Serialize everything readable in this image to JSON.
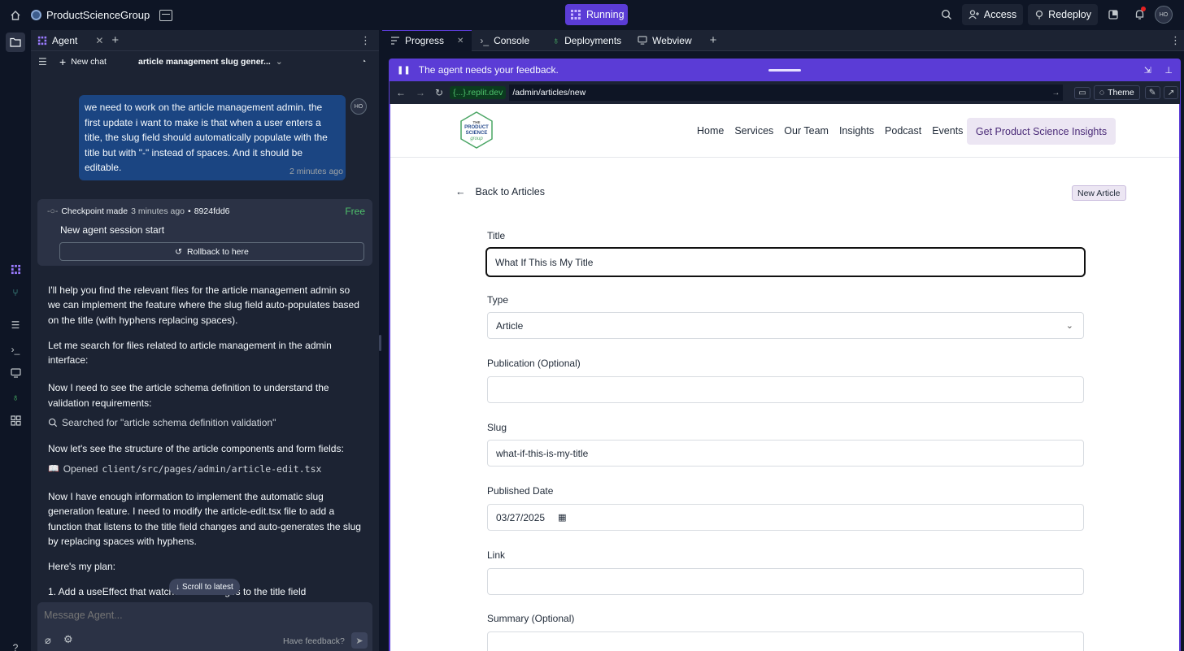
{
  "topbar": {
    "project_name": "ProductScienceGroup",
    "status": "Running",
    "access_label": "Access",
    "redeploy_label": "Redeploy",
    "avatar": "HO"
  },
  "agent": {
    "tab_label": "Agent",
    "new_chat": "New chat",
    "chat_title": "article management slug gener...",
    "user_message": "we need to work on the article management admin. the first update i want to make is that when a user enters a title, the slug field should automatically populate with the title but with \"-\" instead of spaces. And it should be editable.",
    "user_avatar": "HO",
    "timestamp": "2 minutes ago",
    "checkpoint": {
      "label": "Checkpoint made",
      "time": "3 minutes ago",
      "bullet": "•",
      "hash": "8924fdd6",
      "price": "Free",
      "title": "New agent session start",
      "rollback": "Rollback to here"
    },
    "messages": {
      "m1": "I'll help you find the relevant files for the article management admin so we can implement the feature where the slug field auto-populates based on the title (with hyphens replacing spaces).",
      "m2": "Let me search for files related to article management in the admin interface:",
      "m3": "Now I need to see the article schema definition to understand the validation requirements:",
      "tool1": "Searched for \"article schema definition validation\"",
      "m4": "Now let's see the structure of the article components and form fields:",
      "tool2_prefix": "Opened",
      "tool2_file": "client/src/pages/admin/article-edit.tsx",
      "m5": "Now I have enough information to implement the automatic slug generation feature. I need to modify the article-edit.tsx file to add a function that listens to the title field changes and auto-generates the slug by replacing spaces with hyphens.",
      "m6": "Here's my plan:",
      "m7": "1. Add a useEffect that watches the changes to the title field"
    },
    "scroll_latest": "Scroll to latest",
    "input_placeholder": "Message Agent...",
    "have_feedback": "Have feedback?"
  },
  "right": {
    "tabs": [
      "Progress",
      "Console",
      "Deployments",
      "Webview"
    ],
    "feedback_text": "The agent needs your feedback.",
    "url_domain": "{...}.replit.dev",
    "url_path": "/admin/articles/new",
    "theme_label": "Theme"
  },
  "site": {
    "logo_line1": "THE",
    "logo_line2": "PRODUCT",
    "logo_line3": "SCIENCE",
    "logo_line4": "group",
    "nav": [
      "Home",
      "Services",
      "Our Team",
      "Insights",
      "Podcast",
      "Events"
    ],
    "cta": "Get Product Science Insights",
    "back": "Back to Articles",
    "badge": "New Article",
    "fields": {
      "title_label": "Title",
      "title_value": "What If This is My Title",
      "type_label": "Type",
      "type_value": "Article",
      "publication_label": "Publication (Optional)",
      "slug_label": "Slug",
      "slug_value": "what-if-this-is-my-title",
      "date_label": "Published Date",
      "date_value": "03/27/2025",
      "link_label": "Link",
      "summary_label": "Summary (Optional)"
    }
  },
  "colors": {
    "accent": "#5b3cd6",
    "user_bubble": "#1b4582",
    "free": "#4ec06b"
  }
}
